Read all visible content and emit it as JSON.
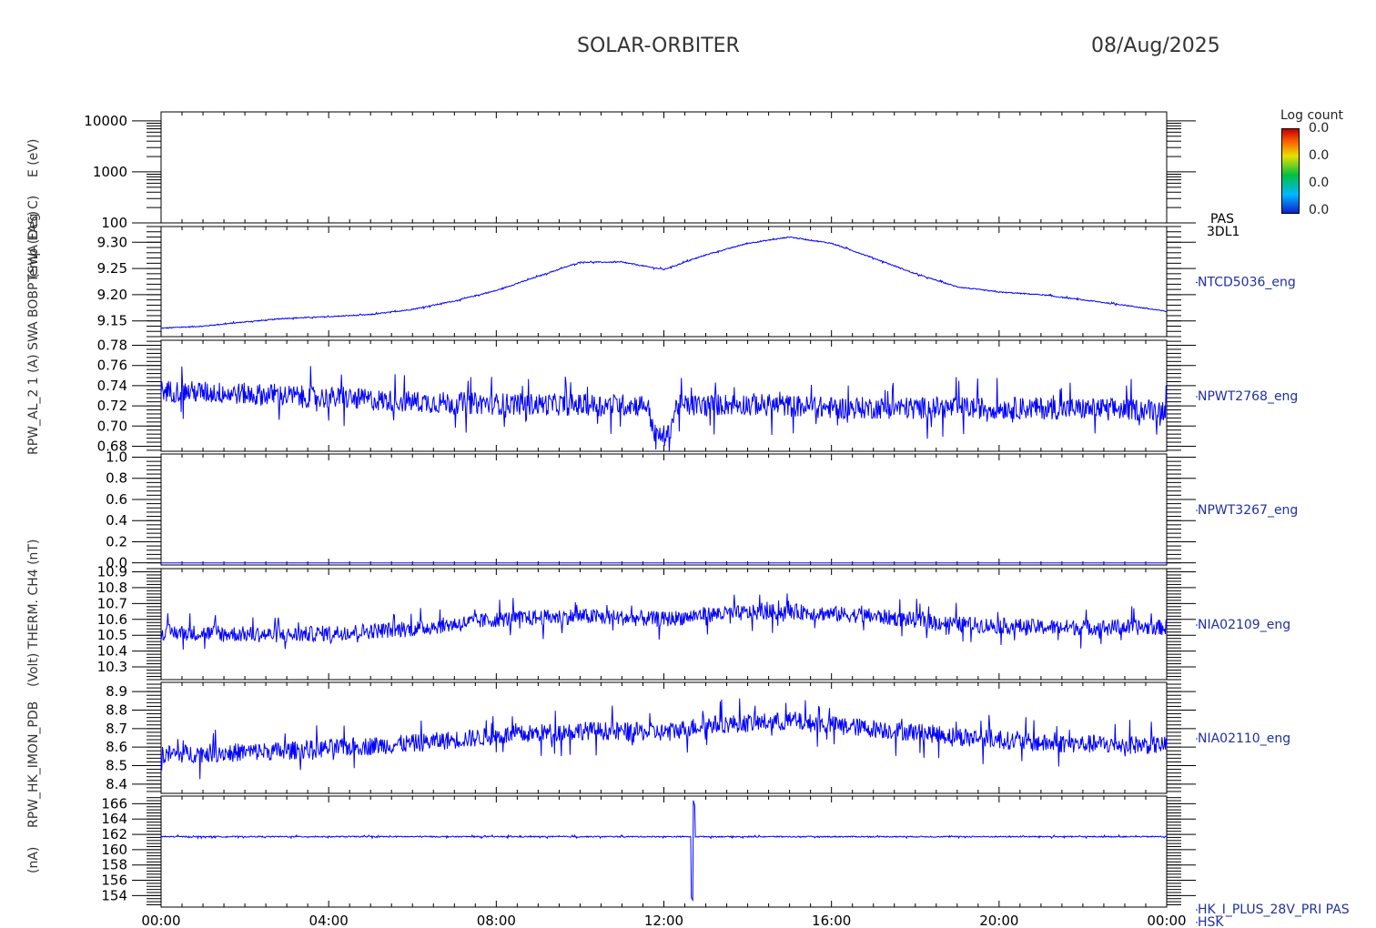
{
  "header": {
    "mission": "SOLAR-ORBITER",
    "date": "08/Aug/2025"
  },
  "y_labels": [
    "(nA)",
    "RPW_HK_IMON_PDB",
    "(Volt) THERM. CH4 (nT)",
    "RPW_AL_2 1 (A) SWA BOBP (SWA EAS)",
    "Temp (Deg C)",
    "E (eV)"
  ],
  "colorbar": {
    "title": "Log count",
    "ticks": [
      "0.0",
      "0.0",
      "0.0",
      "0.0"
    ],
    "colors": [
      "#1020d0",
      "#00b8ff",
      "#00c040",
      "#e8e000",
      "#ff6000",
      "#c00000"
    ]
  },
  "colors": {
    "trace": "#0000ff",
    "axis": "#000000",
    "label": "#2030a0"
  },
  "chart_data": {
    "type": "line",
    "x_ticks": [
      "00:00",
      "04:00",
      "08:00",
      "12:00",
      "16:00",
      "20:00",
      "00:00"
    ],
    "x_range_hours": [
      0,
      24
    ],
    "panels": [
      {
        "id": "pas-3dl1",
        "type": "heatmap",
        "label": [
          "PAS",
          "3DL1"
        ],
        "ylim": [
          100,
          15000
        ],
        "log": true,
        "yticks": [
          100,
          1000,
          10000
        ],
        "ytick_labels": [
          "100",
          "1000",
          "10000"
        ],
        "series": []
      },
      {
        "id": "ntcd5036",
        "label": [
          "NTCD5036_eng"
        ],
        "ylim": [
          9.12,
          9.33
        ],
        "yticks": [
          9.15,
          9.2,
          9.25,
          9.3
        ],
        "ytick_labels": [
          "9.15",
          "9.20",
          "9.25",
          "9.30"
        ],
        "noise": 0.002,
        "base": [
          [
            0,
            9.136
          ],
          [
            1,
            9.14
          ],
          [
            2,
            9.148
          ],
          [
            3,
            9.155
          ],
          [
            4,
            9.158
          ],
          [
            5,
            9.162
          ],
          [
            6,
            9.172
          ],
          [
            7,
            9.188
          ],
          [
            8,
            9.208
          ],
          [
            9,
            9.235
          ],
          [
            10,
            9.262
          ],
          [
            11,
            9.262
          ],
          [
            12,
            9.248
          ],
          [
            13,
            9.276
          ],
          [
            14,
            9.298
          ],
          [
            15,
            9.31
          ],
          [
            16,
            9.298
          ],
          [
            17,
            9.27
          ],
          [
            18,
            9.24
          ],
          [
            19,
            9.215
          ],
          [
            20,
            9.205
          ],
          [
            21,
            9.2
          ],
          [
            22,
            9.19
          ],
          [
            23,
            9.18
          ],
          [
            24,
            9.168
          ]
        ]
      },
      {
        "id": "npwt2768",
        "label": [
          "NPWT2768_eng"
        ],
        "ylim": [
          0.675,
          0.785
        ],
        "yticks": [
          0.68,
          0.7,
          0.72,
          0.74,
          0.76,
          0.78
        ],
        "ytick_labels": [
          "0.68",
          "0.70",
          "0.72",
          "0.74",
          "0.76",
          "0.78"
        ],
        "noise": 0.022,
        "base": [
          [
            0,
            0.735
          ],
          [
            2,
            0.732
          ],
          [
            4,
            0.728
          ],
          [
            6,
            0.724
          ],
          [
            8,
            0.722
          ],
          [
            10,
            0.721
          ],
          [
            11.6,
            0.721
          ],
          [
            11.8,
            0.69
          ],
          [
            12.1,
            0.69
          ],
          [
            12.3,
            0.72
          ],
          [
            14,
            0.722
          ],
          [
            16,
            0.718
          ],
          [
            18,
            0.718
          ],
          [
            20,
            0.718
          ],
          [
            22,
            0.717
          ],
          [
            24,
            0.716
          ]
        ]
      },
      {
        "id": "npwt3267",
        "label": [
          "NPWT3267_eng"
        ],
        "ylim": [
          -0.02,
          1.03
        ],
        "yticks": [
          0.0,
          0.2,
          0.4,
          0.6,
          0.8,
          1.0
        ],
        "ytick_labels": [
          "0.0",
          "0.2",
          "0.4",
          "0.6",
          "0.8",
          "1.0"
        ],
        "noise": 0.0,
        "base": [
          [
            0,
            0.0
          ],
          [
            24,
            0.0
          ]
        ]
      },
      {
        "id": "nia02109",
        "label": [
          "NIA02109_eng"
        ],
        "ylim": [
          10.22,
          10.92
        ],
        "yticks": [
          10.3,
          10.4,
          10.5,
          10.6,
          10.7,
          10.8,
          10.9
        ],
        "ytick_labels": [
          "10.3",
          "10.4",
          "10.5",
          "10.6",
          "10.7",
          "10.8",
          "10.9"
        ],
        "noise": 0.1,
        "base": [
          [
            0,
            10.52
          ],
          [
            3,
            10.5
          ],
          [
            6,
            10.54
          ],
          [
            8,
            10.6
          ],
          [
            10,
            10.62
          ],
          [
            12,
            10.6
          ],
          [
            13,
            10.63
          ],
          [
            15,
            10.65
          ],
          [
            17,
            10.62
          ],
          [
            19,
            10.57
          ],
          [
            21,
            10.55
          ],
          [
            24,
            10.55
          ]
        ]
      },
      {
        "id": "nia02110",
        "label": [
          "NIA02110_eng"
        ],
        "ylim": [
          8.35,
          8.95
        ],
        "yticks": [
          8.4,
          8.5,
          8.6,
          8.7,
          8.8,
          8.9
        ],
        "ytick_labels": [
          "8.4",
          "8.5",
          "8.6",
          "8.7",
          "8.8",
          "8.9"
        ],
        "noise": 0.1,
        "base": [
          [
            0,
            8.56
          ],
          [
            3,
            8.58
          ],
          [
            6,
            8.62
          ],
          [
            8,
            8.66
          ],
          [
            10,
            8.69
          ],
          [
            12,
            8.68
          ],
          [
            13,
            8.72
          ],
          [
            15,
            8.74
          ],
          [
            17,
            8.7
          ],
          [
            19,
            8.66
          ],
          [
            21,
            8.62
          ],
          [
            24,
            8.61
          ]
        ]
      },
      {
        "id": "hk-i-plus",
        "label": [
          "HK_I_PLUS_28V_PRI PAS",
          "HSK"
        ],
        "ylim": [
          152.5,
          167
        ],
        "yticks": [
          154,
          156,
          158,
          160,
          162,
          164,
          166
        ],
        "ytick_labels": [
          "154",
          "156",
          "158",
          "160",
          "162",
          "164",
          "166"
        ],
        "noise": 0.15,
        "base": [
          [
            0,
            161.7
          ],
          [
            24,
            161.7
          ]
        ],
        "spike": {
          "x": 12.7,
          "low": 153.3,
          "high": 166.5
        }
      }
    ]
  }
}
